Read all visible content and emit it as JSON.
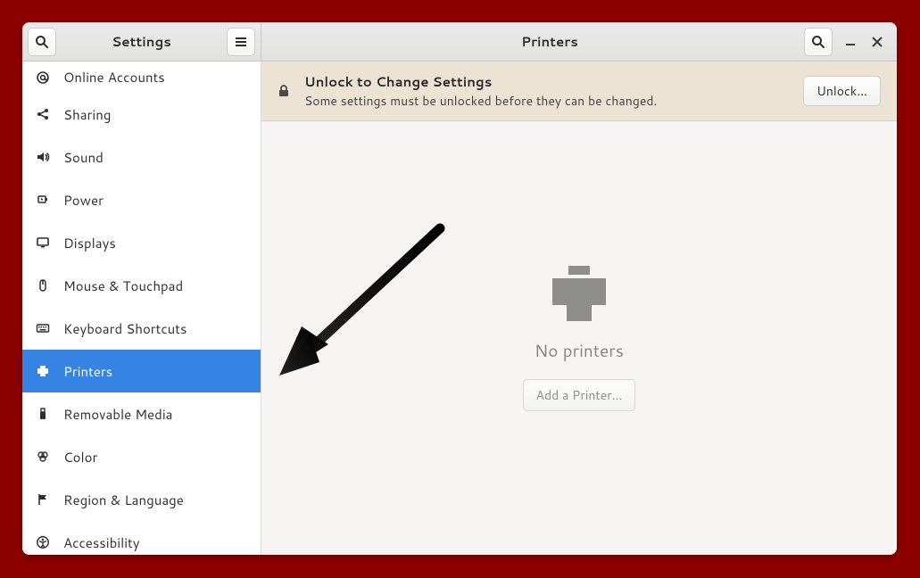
{
  "titlebar": {
    "left_title": "Settings",
    "right_title": "Printers"
  },
  "sidebar": {
    "items": [
      {
        "id": "online-accounts",
        "label": "Online Accounts",
        "icon": "at",
        "selected": false,
        "short": true
      },
      {
        "id": "sharing",
        "label": "Sharing",
        "icon": "share",
        "selected": false
      },
      {
        "id": "sound",
        "label": "Sound",
        "icon": "sound",
        "selected": false
      },
      {
        "id": "power",
        "label": "Power",
        "icon": "power",
        "selected": false
      },
      {
        "id": "displays",
        "label": "Displays",
        "icon": "display",
        "selected": false
      },
      {
        "id": "mouse",
        "label": "Mouse & Touchpad",
        "icon": "mouse",
        "selected": false
      },
      {
        "id": "keyboard",
        "label": "Keyboard Shortcuts",
        "icon": "keyboard",
        "selected": false
      },
      {
        "id": "printers",
        "label": "Printers",
        "icon": "printer",
        "selected": true
      },
      {
        "id": "removable",
        "label": "Removable Media",
        "icon": "usb",
        "selected": false
      },
      {
        "id": "color",
        "label": "Color",
        "icon": "color",
        "selected": false
      },
      {
        "id": "region",
        "label": "Region & Language",
        "icon": "flag",
        "selected": false
      },
      {
        "id": "accessibility",
        "label": "Accessibility",
        "icon": "accessibility",
        "selected": false
      }
    ]
  },
  "infobar": {
    "title": "Unlock to Change Settings",
    "subtitle": "Some settings must be unlocked before they can be changed.",
    "button": "Unlock…"
  },
  "content": {
    "empty_label": "No printers",
    "add_button": "Add a Printer…"
  }
}
